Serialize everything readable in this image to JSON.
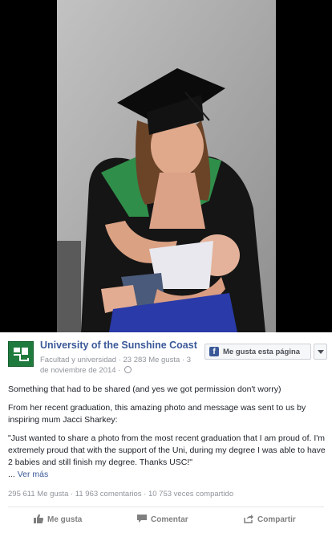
{
  "page": {
    "name": "University of the Sunshine Coast",
    "meta_line1": "Facultad y universidad · 23 283 Me gusta · 3",
    "meta_line2": "de noviembre de 2014 ·",
    "like_page_button": "Me gusta esta página",
    "brand_color": "#3b5998",
    "logo_color": "#1f7a3d"
  },
  "post": {
    "paragraph1": "Something that had to be shared (and yes we got permission don't worry)",
    "paragraph2": "From her recent graduation, this amazing photo and message was sent to us by inspiring mum Jacci Sharkey:",
    "paragraph3": "\"Just wanted to share a photo from the most recent graduation that I am proud of. I'm extremely proud that with the support of the Uni, during my degree I was able to have 2 babies and still finish my degree. Thanks USC!\"",
    "ellipsis": "...",
    "see_more": "Ver más"
  },
  "stats": {
    "text": "295 611 Me gusta · 11 963 comentarios · 10 753 veces compartido"
  },
  "actions": {
    "like": "Me gusta",
    "comment": "Comentar",
    "share": "Compartir"
  },
  "icons": {
    "like": "thumbs-up-icon",
    "comment": "comment-icon",
    "share": "share-icon",
    "globe": "globe-icon",
    "facebook": "facebook-icon",
    "caret": "chevron-down-icon"
  }
}
